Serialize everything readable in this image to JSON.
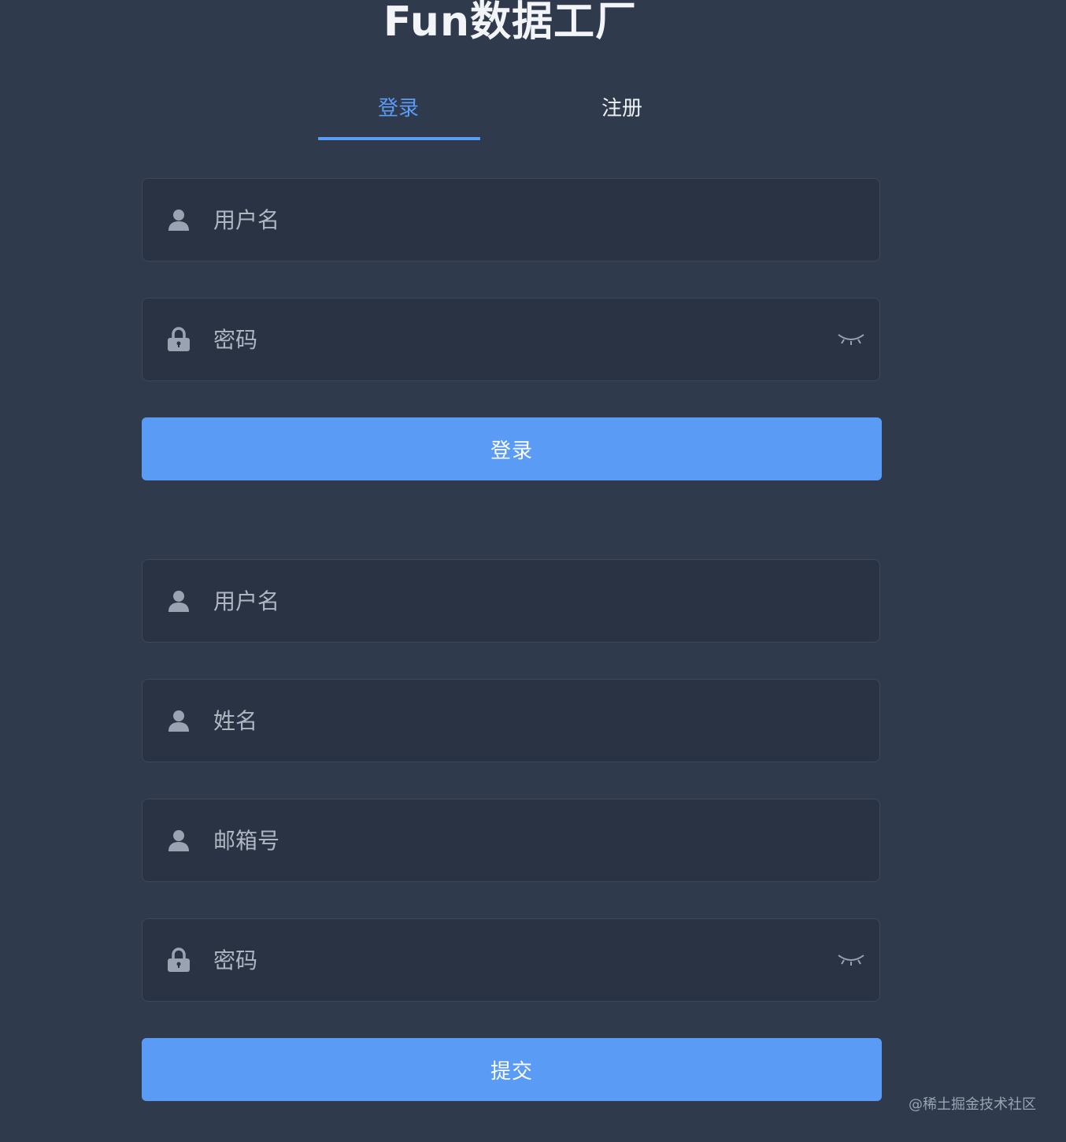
{
  "title": "Fun数据工厂",
  "tabs": [
    {
      "label": "登录",
      "active": true
    },
    {
      "label": "注册",
      "active": false
    }
  ],
  "login_form": {
    "username_placeholder": "用户名",
    "password_placeholder": "密码",
    "submit_label": "登录"
  },
  "register_form": {
    "username_placeholder": "用户名",
    "name_placeholder": "姓名",
    "email_placeholder": "邮箱号",
    "password_placeholder": "密码",
    "submit_label": "提交"
  },
  "watermark": "@稀土掘金技术社区",
  "colors": {
    "background": "#2f3a4d",
    "field_background": "#2a3344",
    "accent": "#5a9bf6",
    "icon": "#9aa3b1"
  },
  "icons": {
    "user": "user-icon",
    "lock": "lock-icon",
    "password_toggle": "eye-closed-icon"
  }
}
